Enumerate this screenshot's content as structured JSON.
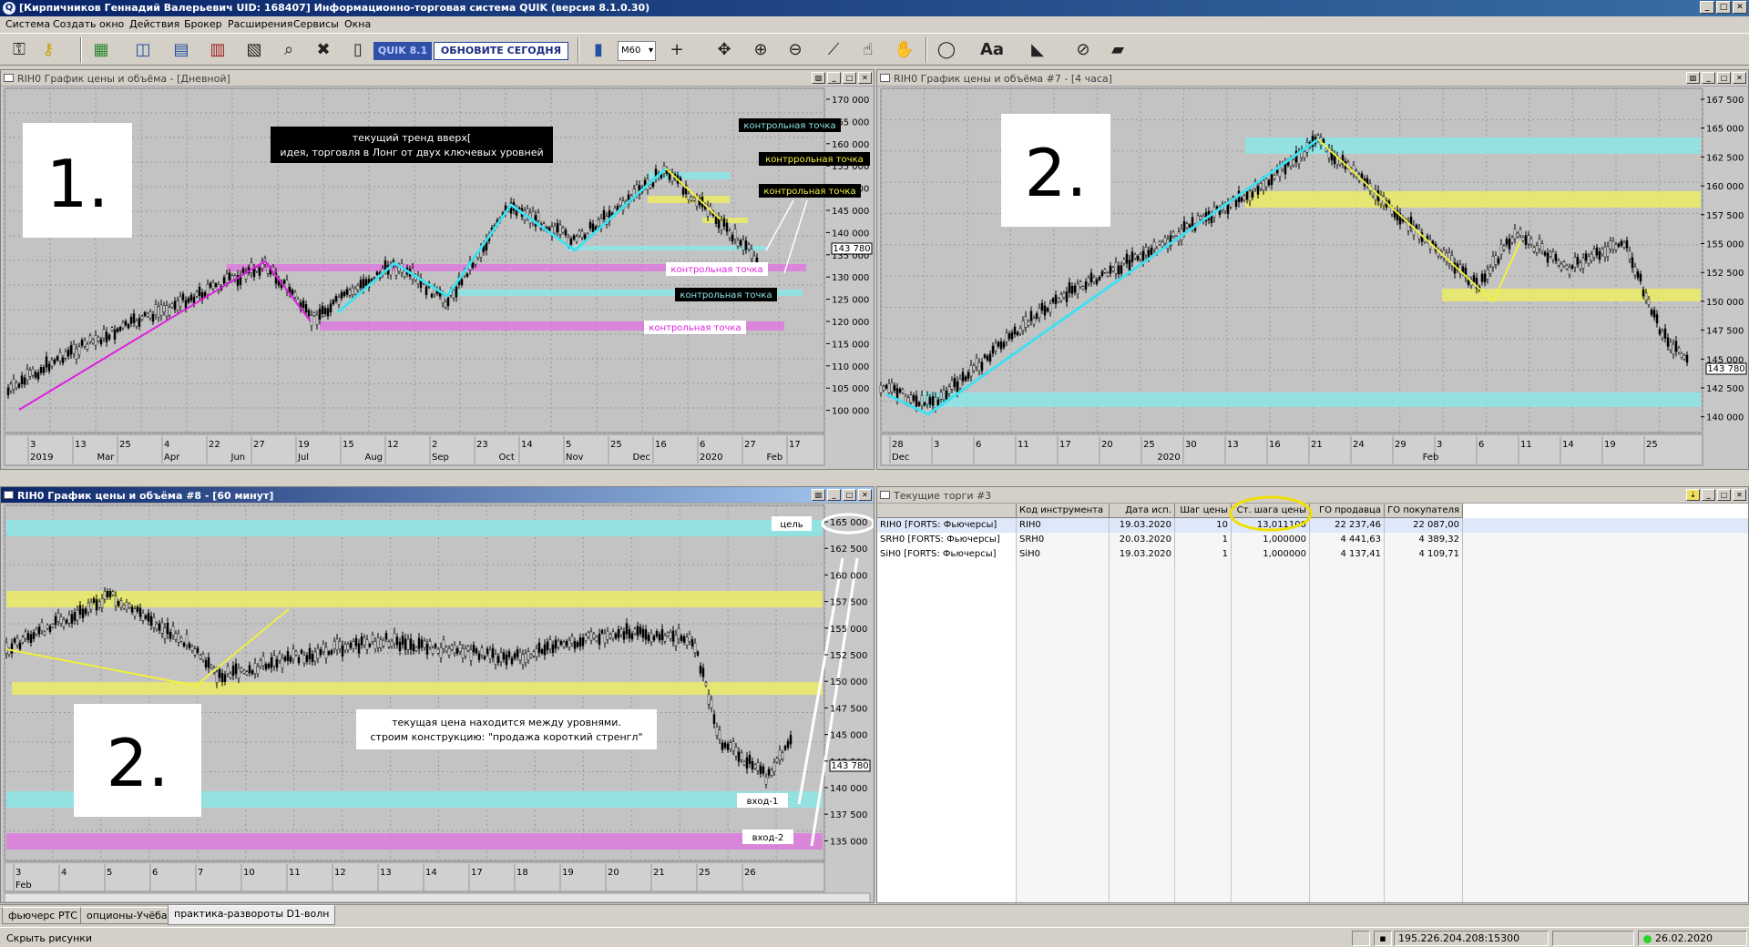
{
  "window": {
    "title": "[Кирпичников Геннадий Валерьевич UID: 168407] Информационно-торговая система QUIK (версия 8.1.0.30)",
    "buttons": [
      "_",
      "□",
      "✕"
    ]
  },
  "menu": [
    "Система",
    "Создать окно",
    "Действия",
    "Брокер",
    "Расширения",
    "Сервисы",
    "Окна"
  ],
  "toolbar": {
    "quik_badge": "QUIK 8.1",
    "update_button": "ОБНОВИТЕ СЕГОДНЯ",
    "interval": "M60",
    "font_label": "Aa"
  },
  "charts": {
    "daily": {
      "title": "RIH0 График цены и объёма - [Дневной]",
      "big_number": "1.",
      "y_ticks": [
        "170 000",
        "165 000",
        "160 000",
        "155 000",
        "150 000",
        "145 000",
        "140 000",
        "135 000",
        "130 000",
        "125 000",
        "120 000",
        "115 000",
        "110 000",
        "105 000",
        "100 000"
      ],
      "price_tag": "143 780",
      "x_days": [
        "3",
        "13",
        "25",
        "4",
        "22",
        "27",
        "19",
        "15",
        "12",
        "2",
        "23",
        "14",
        "5",
        "25",
        "16",
        "6",
        "27",
        "17"
      ],
      "x_months": [
        "2019",
        "Mar",
        "Apr",
        "Jun",
        "Jul",
        "Aug",
        "Sep",
        "Oct",
        "Nov",
        "Dec",
        "2020",
        "Feb"
      ],
      "annotation_trend_line1": "текущий тренд вверх[",
      "annotation_trend_line2": "идея, торговля в Лонг от двух ключевых уровней",
      "labels": [
        "контрольная точка",
        "контррольная точка",
        "контрольная точка",
        "контрольная точка",
        "контрольная точка",
        "контрольная точка"
      ]
    },
    "h4": {
      "title": "RIH0 График цены и объёма #7 - [4 часа]",
      "big_number": "2.",
      "y_ticks": [
        "167 500",
        "165 000",
        "162 500",
        "160 000",
        "157 500",
        "155 000",
        "152 500",
        "150 000",
        "147 500",
        "145 000",
        "142 500",
        "140 000"
      ],
      "price_tag": "143 780",
      "x_days": [
        "28",
        "3",
        "6",
        "11",
        "17",
        "20",
        "25",
        "30",
        "13",
        "16",
        "21",
        "24",
        "29",
        "3",
        "6",
        "11",
        "14",
        "19",
        "25"
      ],
      "x_months": [
        "Dec",
        "2020",
        "Feb"
      ]
    },
    "h1": {
      "title": "RIH0 График цены и объёма #8 - [60 минут]",
      "big_number": "2.",
      "y_ticks": [
        "165 000",
        "162 500",
        "160 000",
        "157 500",
        "155 000",
        "152 500",
        "150 000",
        "147 500",
        "145 000",
        "142 500",
        "140 000",
        "137 500",
        "135 000"
      ],
      "price_tag": "143 780",
      "x_days": [
        "3",
        "4",
        "5",
        "6",
        "7",
        "10",
        "11",
        "12",
        "13",
        "14",
        "17",
        "18",
        "19",
        "20",
        "21",
        "25",
        "26"
      ],
      "x_months": [
        "Feb"
      ],
      "label_target": "цель",
      "label_entry1": "вход-1",
      "label_entry2": "вход-2",
      "annotation_line1": "текущая цена находится между уровнями.",
      "annotation_line2": "строим конструкцию: \"продажа короткий стренгл\""
    }
  },
  "trades": {
    "title": "Текущие торги #3",
    "columns": [
      "Код инструмента",
      "Дата исп.",
      "Шаг цены",
      "Ст. шага цены",
      "ГО продавца",
      "ГО покупателя"
    ],
    "rows": [
      {
        "name": "RIH0 [FORTS: Фьючерсы]",
        "code": "RIH0",
        "date": "19.03.2020",
        "step": "10",
        "step_cost": "13,011100",
        "go_sell": "22 237,46",
        "go_buy": "22 087,00"
      },
      {
        "name": "SRH0 [FORTS: Фьючерсы]",
        "code": "SRH0",
        "date": "20.03.2020",
        "step": "1",
        "step_cost": "1,000000",
        "go_sell": "4 441,63",
        "go_buy": "4 389,32"
      },
      {
        "name": "SiH0 [FORTS: Фьючерсы]",
        "code": "SiH0",
        "date": "19.03.2020",
        "step": "1",
        "step_cost": "1,000000",
        "go_sell": "4 137,41",
        "go_buy": "4 109,71"
      }
    ]
  },
  "tabs": [
    "фьючерс РТС",
    "опционы-Учёба",
    "практика-развороты D1-волн"
  ],
  "status": {
    "left": "Скрыть рисунки",
    "connection": "195.226.204.208:15300",
    "date": "26.02.2020"
  }
}
